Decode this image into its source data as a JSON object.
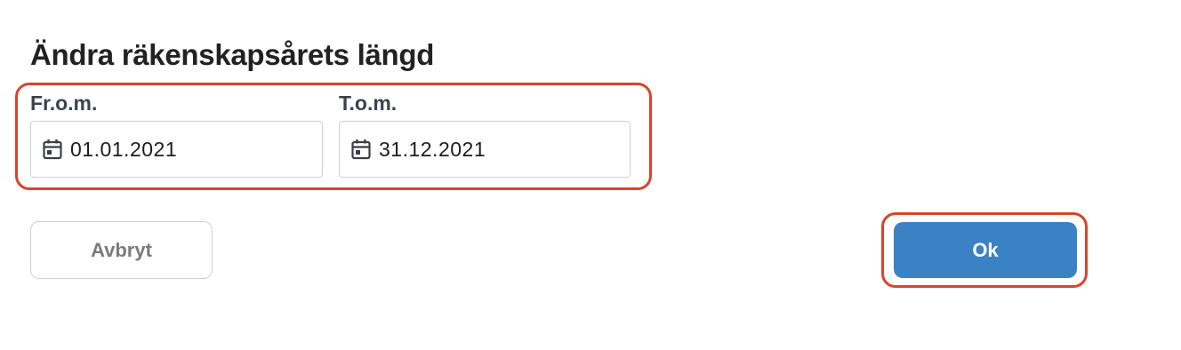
{
  "dialog": {
    "title": "Ändra räkenskapsårets längd"
  },
  "date_range": {
    "from": {
      "label": "Fr.o.m.",
      "value": "01.01.2021",
      "icon": "calendar-icon"
    },
    "to": {
      "label": "T.o.m.",
      "value": "31.12.2021",
      "icon": "calendar-icon"
    }
  },
  "actions": {
    "cancel_label": "Avbryt",
    "ok_label": "Ok"
  },
  "colors": {
    "primary": "#3b82c4",
    "highlight": "#d9442b",
    "border": "#cfcfcf"
  }
}
